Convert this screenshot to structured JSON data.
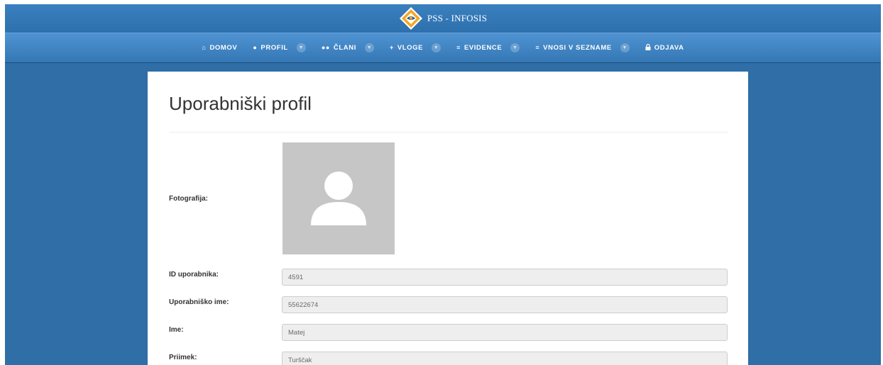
{
  "app": {
    "brand": "PSS - INFOSIS"
  },
  "nav": {
    "items": [
      {
        "icon": "home-icon",
        "label": "DOMOV",
        "dropdown": false
      },
      {
        "icon": "user-icon",
        "label": "PROFIL",
        "dropdown": true
      },
      {
        "icon": "users-icon",
        "label": "ČLANI",
        "dropdown": true
      },
      {
        "icon": "plus-icon",
        "label": "VLOGE",
        "dropdown": true
      },
      {
        "icon": "list-icon",
        "label": "EVIDENCE",
        "dropdown": true
      },
      {
        "icon": "list-icon",
        "label": "VNOSI V SEZNAME",
        "dropdown": true
      },
      {
        "icon": "lock-icon",
        "label": "ODJAVA",
        "dropdown": false
      }
    ]
  },
  "profile": {
    "title": "Uporabniški profil",
    "photo_label": "Fotografija:",
    "fields": [
      {
        "label": "ID uporabnika:",
        "value": "4591"
      },
      {
        "label": "Uporabniško ime:",
        "value": "55622674"
      },
      {
        "label": "Ime:",
        "value": "Matej"
      },
      {
        "label": "Priimek:",
        "value": "Turščak"
      }
    ]
  },
  "colors": {
    "background": "#2f6ea6",
    "navbar": "#3f86c6",
    "card": "#ffffff",
    "field_bg": "#eeeeee",
    "avatar_bg": "#c6c6c6",
    "logo_orange": "#f5a623"
  }
}
